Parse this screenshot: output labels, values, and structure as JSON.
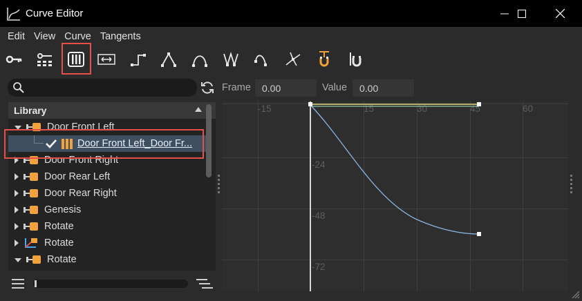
{
  "window": {
    "title": "Curve Editor"
  },
  "menu": {
    "items": [
      "Edit",
      "View",
      "Curve",
      "Tangents"
    ]
  },
  "toolbar": {
    "buttons": [
      "key-icon",
      "keys-grid-icon",
      "tracks-icon",
      "fit-horizontal-icon",
      "step-icon",
      "linear-icon",
      "ease-icon",
      "zigzag-icon",
      "ease-out-icon",
      "spline-tangent-icon",
      "magnet-icon",
      "magnet-snap-icon"
    ],
    "active": "tracks-icon"
  },
  "search": {
    "value": "",
    "placeholder": ""
  },
  "tree": {
    "header": "Library",
    "items": [
      {
        "label": "Door Front Left",
        "expanded": true
      },
      {
        "label": "Door Front Left_Door Fr...",
        "selected": true,
        "checked": true
      },
      {
        "label": "Door Front Right",
        "expanded": false
      },
      {
        "label": "Door Rear Left",
        "expanded": false
      },
      {
        "label": "Door Rear Right",
        "expanded": false
      },
      {
        "label": "Genesis",
        "expanded": false
      },
      {
        "label": "Rotate",
        "expanded": false
      },
      {
        "label": "Rotate",
        "expanded": false,
        "icon": "axis-icon"
      },
      {
        "label": "Rotate",
        "expanded": true
      }
    ]
  },
  "fields": {
    "frame_label": "Frame",
    "frame_value": "0.00",
    "value_label": "Value",
    "value_value": "0.00"
  },
  "graph": {
    "x_ticks": [
      "-15",
      "15",
      "30",
      "45",
      "60"
    ],
    "y_ticks": [
      "-24",
      "-48",
      "-72"
    ],
    "curve_color": "#8cb4e0",
    "flat_line_color": "#b8b070",
    "accent_color": "#f2a23a",
    "highlight_color": "#e4514b"
  }
}
